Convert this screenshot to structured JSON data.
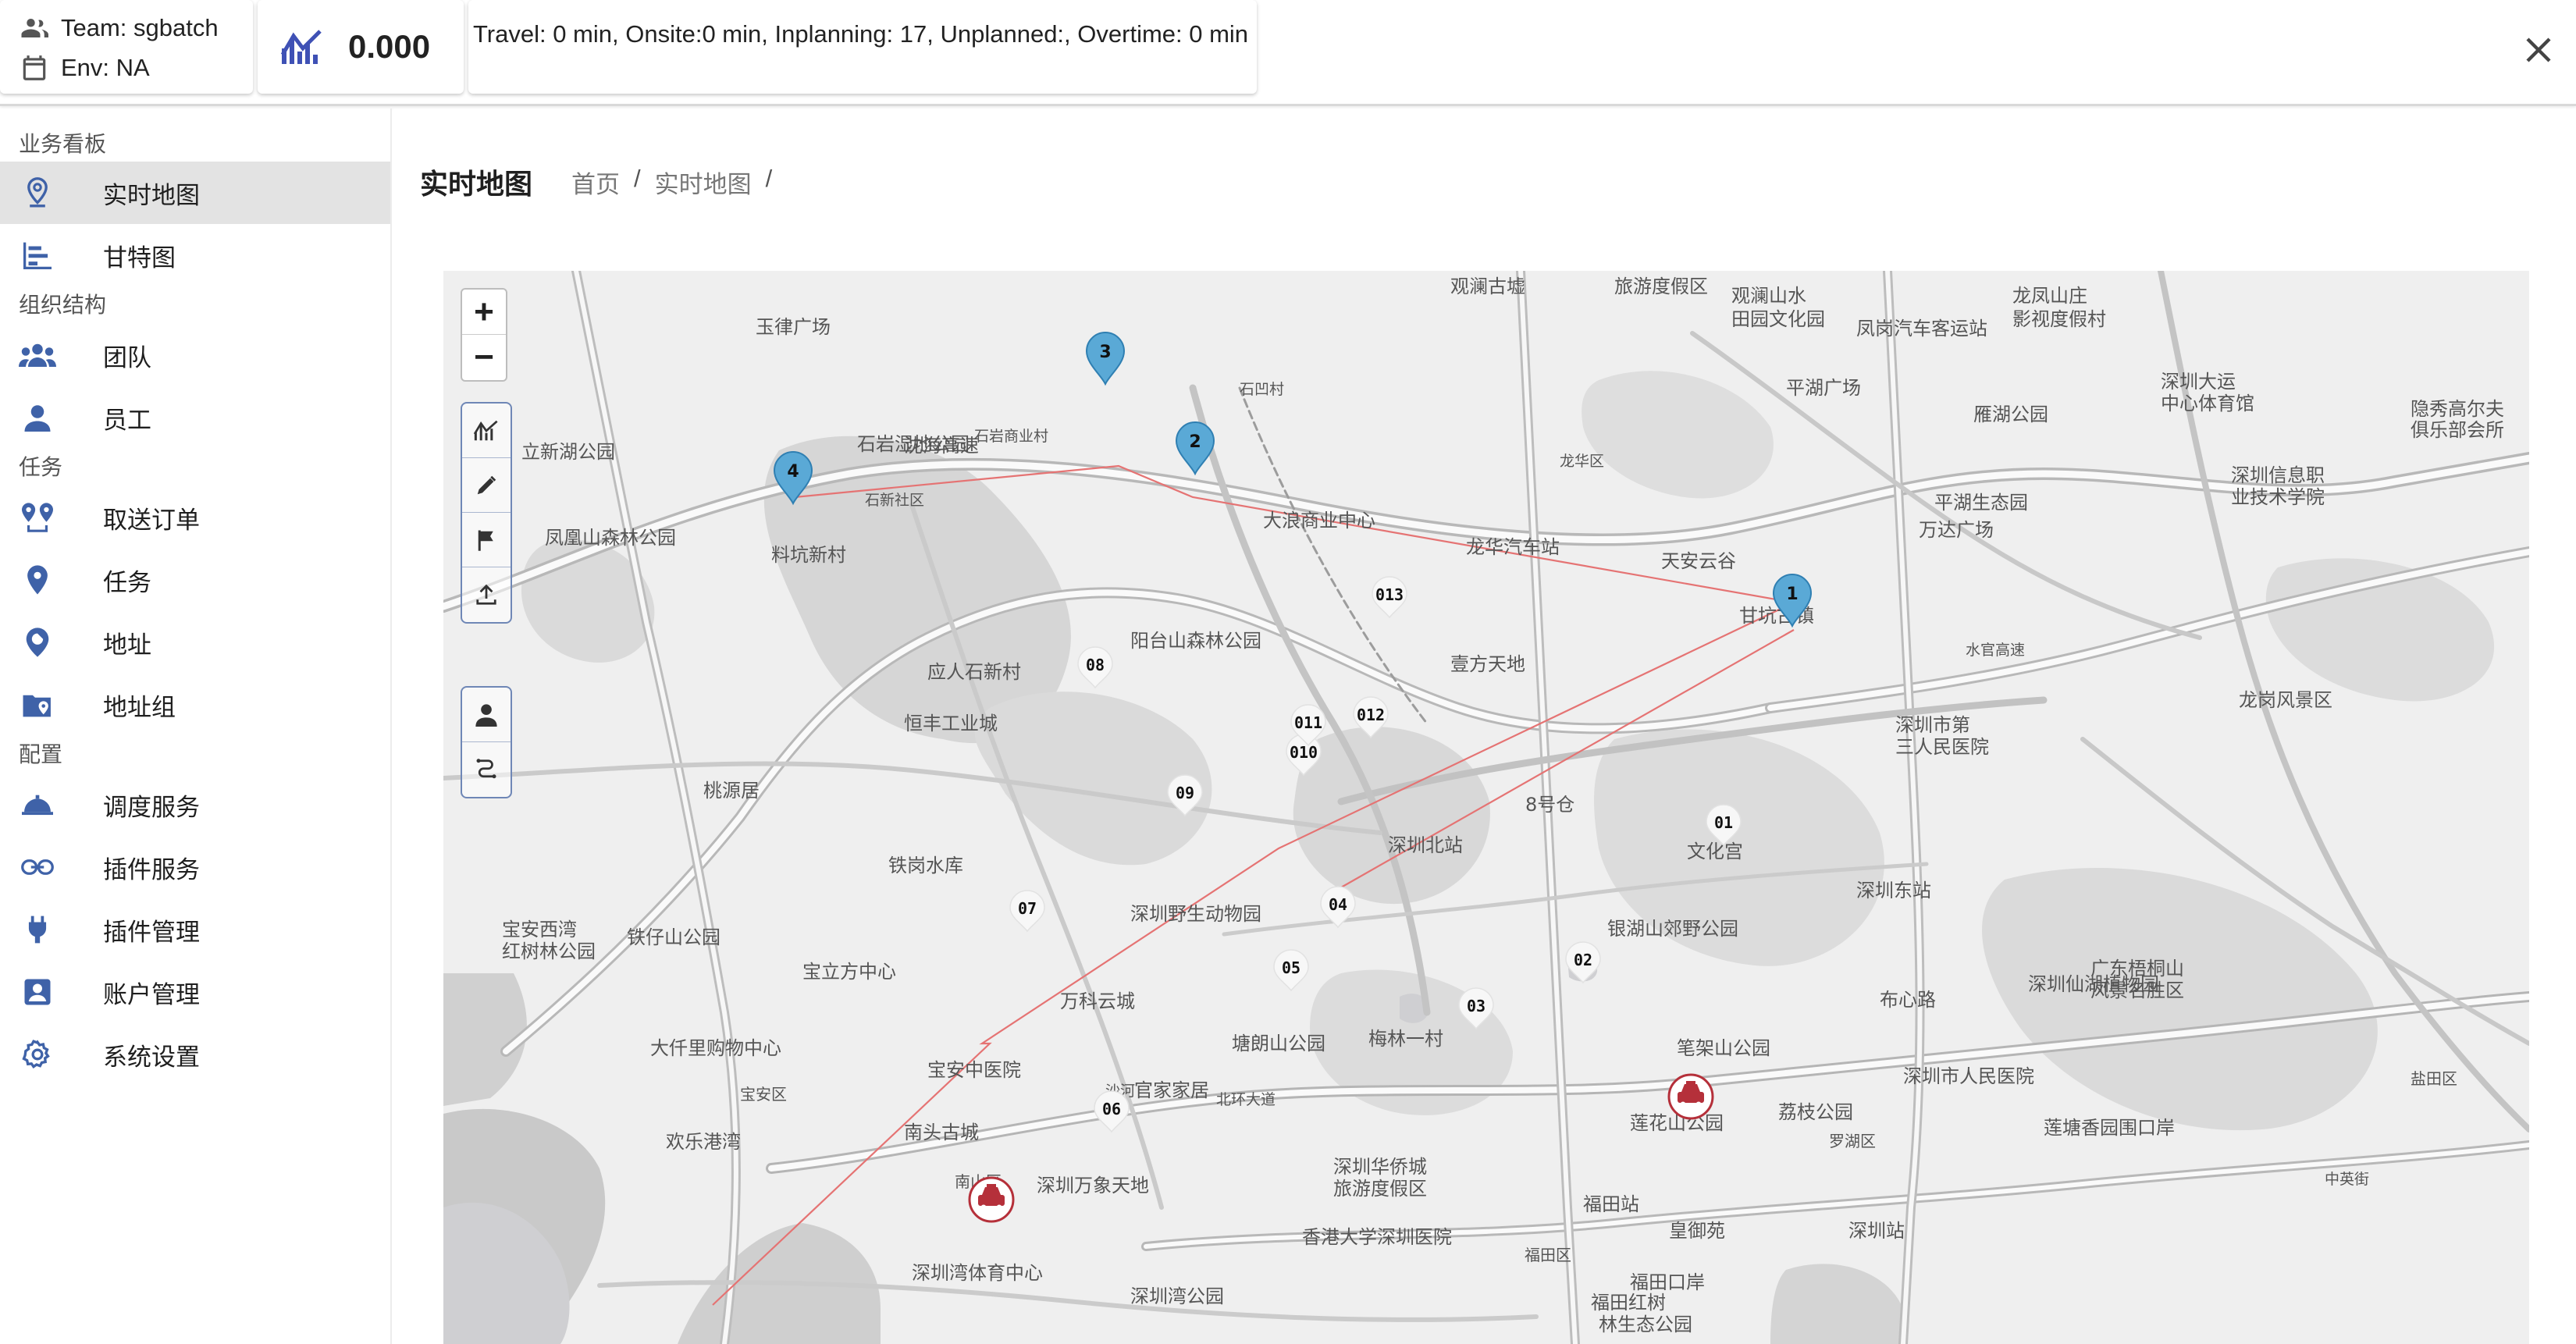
{
  "header": {
    "team_label": "Team: sgbatch",
    "env_label": "Env: NA",
    "kpi_value": "0.000",
    "stats": "Travel: 0 min, Onsite:0 min, Inplanning: 17, Unplanned:, Overtime: 0 min"
  },
  "sidebar": {
    "sections": [
      {
        "title": "业务看板",
        "items": [
          {
            "label": "实时地图",
            "icon": "map-pin-icon",
            "active": true
          },
          {
            "label": "甘特图",
            "icon": "gantt-icon"
          }
        ]
      },
      {
        "title": "组织结构",
        "items": [
          {
            "label": "团队",
            "icon": "team-icon"
          },
          {
            "label": "员工",
            "icon": "person-icon"
          }
        ]
      },
      {
        "title": "任务",
        "items": [
          {
            "label": "取送订单",
            "icon": "route-pins-icon"
          },
          {
            "label": "任务",
            "icon": "location-icon"
          },
          {
            "label": "地址",
            "icon": "address-pin-icon"
          },
          {
            "label": "地址组",
            "icon": "folder-pin-icon"
          }
        ]
      },
      {
        "title": "配置",
        "items": [
          {
            "label": "调度服务",
            "icon": "cloche-icon"
          },
          {
            "label": "插件服务",
            "icon": "link-icon"
          },
          {
            "label": "插件管理",
            "icon": "plug-icon"
          },
          {
            "label": "账户管理",
            "icon": "account-box-icon"
          },
          {
            "label": "系统设置",
            "icon": "gear-icon"
          }
        ]
      }
    ]
  },
  "page": {
    "title": "实时地图",
    "breadcrumb": [
      "首页",
      "实时地图"
    ]
  },
  "map": {
    "zoom_in": "+",
    "zoom_out": "−",
    "route_markers": [
      "1",
      "2",
      "3",
      "4"
    ],
    "task_labels": [
      "01",
      "02",
      "03",
      "04",
      "05",
      "06",
      "07",
      "08",
      "09",
      "010",
      "011",
      "012",
      "013"
    ],
    "place_labels": [
      {
        "text": "观澜古墟"
      },
      {
        "text": "旅游度假区"
      },
      {
        "text": "观澜山水"
      },
      {
        "text": "田园文化园"
      },
      {
        "text": "凤岗汽车客运站"
      },
      {
        "text": "龙凤山庄"
      },
      {
        "text": "影视度假村"
      },
      {
        "text": "玉律广场"
      },
      {
        "text": "石岩湿地公园"
      },
      {
        "text": "石岩商业村"
      },
      {
        "text": "石新社区"
      },
      {
        "text": "沈海高速"
      },
      {
        "text": "龙华区"
      },
      {
        "text": "石凹村"
      },
      {
        "text": "平湖广场"
      },
      {
        "text": "雁湖公园"
      },
      {
        "text": "深圳大运"
      },
      {
        "text": "中心体育馆"
      },
      {
        "text": "隐秀高尔夫"
      },
      {
        "text": "俱乐部会所"
      },
      {
        "text": "立新湖公园"
      },
      {
        "text": "凤凰山森林公园"
      },
      {
        "text": "料坑新村"
      },
      {
        "text": "大浪商业中心"
      },
      {
        "text": "龙华汽车站"
      },
      {
        "text": "天安云谷"
      },
      {
        "text": "平湖生态园"
      },
      {
        "text": "万达广场"
      },
      {
        "text": "深圳信息职"
      },
      {
        "text": "业技术学院"
      },
      {
        "text": "甘坑古镇"
      },
      {
        "text": "阳台山森林公园"
      },
      {
        "text": "应人石新村"
      },
      {
        "text": "壹方天地"
      },
      {
        "text": "水官高速"
      },
      {
        "text": "恒丰工业城"
      },
      {
        "text": "深圳市第"
      },
      {
        "text": "三人民医院"
      },
      {
        "text": "龙岗风景区"
      },
      {
        "text": "桃源居"
      },
      {
        "text": "8号仓"
      },
      {
        "text": "深圳北站"
      },
      {
        "text": "文化宫"
      },
      {
        "text": "深圳东站"
      },
      {
        "text": "宝安西湾"
      },
      {
        "text": "红树林公园"
      },
      {
        "text": "铁仔山公园"
      },
      {
        "text": "铁岗水库"
      },
      {
        "text": "深圳野生动物园"
      },
      {
        "text": "银湖山郊野公园"
      },
      {
        "text": "宝立方中心"
      },
      {
        "text": "万科云城"
      },
      {
        "text": "梅林一村"
      },
      {
        "text": "塘朗山公园"
      },
      {
        "text": "布心路"
      },
      {
        "text": "深圳仙湖植物园"
      },
      {
        "text": "广东梧桐山"
      },
      {
        "text": "风景名胜区"
      },
      {
        "text": "大仟里购物中心"
      },
      {
        "text": "宝安中医院"
      },
      {
        "text": "宝安区"
      },
      {
        "text": "官家家居"
      },
      {
        "text": "北环大道"
      },
      {
        "text": "笔架山公园"
      },
      {
        "text": "深圳市人民医院"
      },
      {
        "text": "盐田区"
      },
      {
        "text": "欢乐港湾"
      },
      {
        "text": "南头古城"
      },
      {
        "text": "南山区"
      },
      {
        "text": "深圳万象天地"
      },
      {
        "text": "深圳华侨城"
      },
      {
        "text": "旅游度假区"
      },
      {
        "text": "莲花山公园"
      },
      {
        "text": "荔枝公园"
      },
      {
        "text": "罗湖区"
      },
      {
        "text": "莲塘香园围口岸"
      },
      {
        "text": "中英街"
      },
      {
        "text": "香港大学深圳医院"
      },
      {
        "text": "福田站"
      },
      {
        "text": "皇御苑"
      },
      {
        "text": "深圳站"
      },
      {
        "text": "福田区"
      },
      {
        "text": "深圳湾体育中心"
      },
      {
        "text": "深圳湾公园"
      },
      {
        "text": "福田口岸"
      },
      {
        "text": "福田红树"
      },
      {
        "text": "林生态公园"
      },
      {
        "text": "沙河"
      }
    ]
  }
}
